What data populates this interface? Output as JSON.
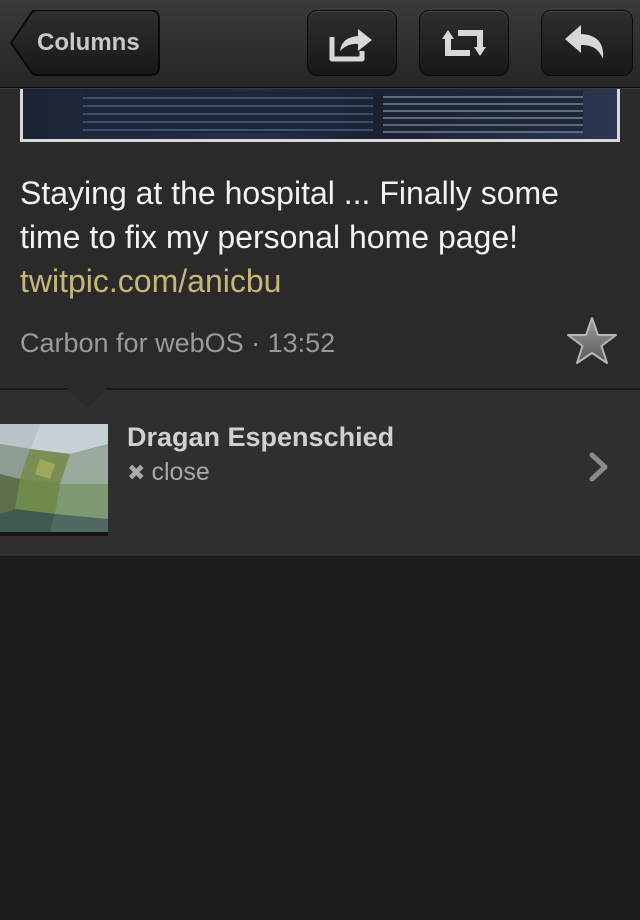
{
  "toolbar": {
    "back_label": "Columns",
    "actions": [
      {
        "icon": "share-icon"
      },
      {
        "icon": "retweet-icon"
      },
      {
        "icon": "reply-icon"
      }
    ]
  },
  "tweet": {
    "text": "Staying at the hospital ... Finally some time to fix my personal home page! ",
    "link": "twitpic.com/anicbu",
    "meta": "Carbon for webOS · 13:52",
    "favorited": false
  },
  "user": {
    "name": "Dragan Espenschied",
    "close_icon": "✖",
    "close_label": "close"
  },
  "colors": {
    "link": "#c8b678",
    "background": "#1c1c1c",
    "panel": "#2a2a2a"
  }
}
